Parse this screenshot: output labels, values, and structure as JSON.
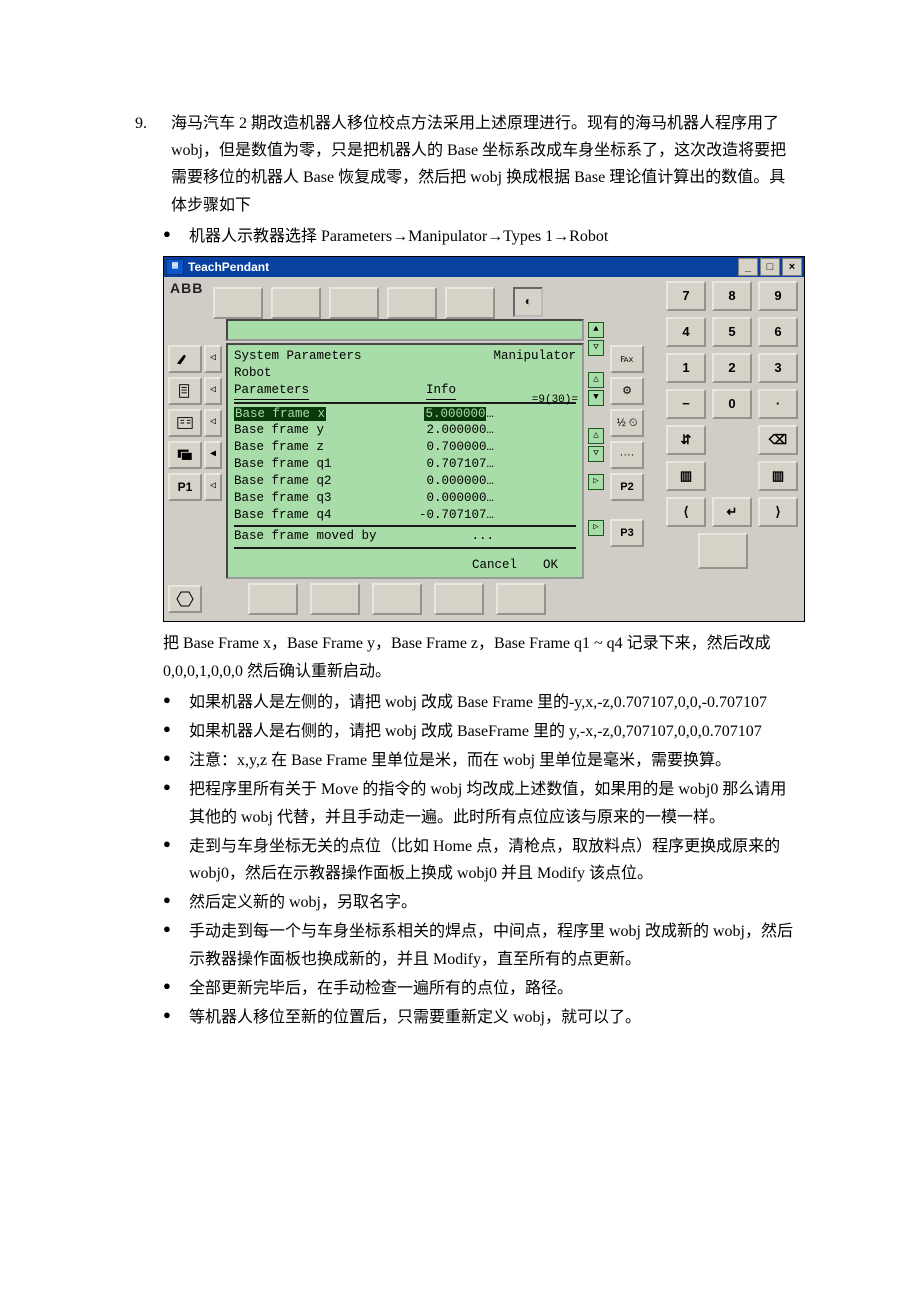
{
  "section": {
    "num": "9.",
    "text": "海马汽车 2 期改造机器人移位校点方法采用上述原理进行。现有的海马机器人程序用了 wobj，但是数值为零，只是把机器人的 Base 坐标系改成车身坐标系了，这次改造将要把需要移位的机器人 Base 恢复成零，然后把 wobj 换成根据 Base 理论值计算出的数值。具体步骤如下"
  },
  "step_nav": "机器人示教器选择 Parameters→Manipulator→Types 1→Robot",
  "pendant": {
    "window_title": "TeachPendant",
    "logo": "ABB",
    "mode_icon": "◐",
    "keypad": {
      "r1": [
        "7",
        "8",
        "9"
      ],
      "r2": [
        "4",
        "5",
        "6"
      ],
      "r3": [
        "1",
        "2",
        "3"
      ],
      "r4": [
        "−",
        "0",
        "·"
      ]
    },
    "screen": {
      "title_left": "System Parameters",
      "title_right": "Manipulator",
      "line2_left": "Robot",
      "menu_left": "Parameters",
      "menu_right": "Info",
      "counter": "=9(30)=",
      "rows": [
        {
          "k": "Base frame x",
          "v": "5.000000",
          "sel": true
        },
        {
          "k": "Base frame y",
          "v": "2.000000"
        },
        {
          "k": "Base frame z",
          "v": "0.700000"
        },
        {
          "k": "Base frame q1",
          "v": "0.707107"
        },
        {
          "k": "Base frame q2",
          "v": "0.000000"
        },
        {
          "k": "Base frame q3",
          "v": "0.000000"
        },
        {
          "k": "Base frame q4",
          "v": "-0.707107"
        },
        {
          "k": "Base frame moved by",
          "v": "..."
        }
      ],
      "footer": {
        "cancel": "Cancel",
        "ok": "OK"
      }
    },
    "left_icons": [
      "pen",
      "doc",
      "io",
      "windows",
      "p1"
    ],
    "left_labels": {
      "p1": "P1"
    },
    "fn": {
      "top": "℻",
      "mid1": "⚙",
      "mid2": "½ ⏲",
      "bot": "····",
      "p2": "P2",
      "p3": "P3"
    },
    "right_icons": {
      "tree": "⇵",
      "del": "⌫",
      "fileA": "▥",
      "fileB": "▥",
      "arrowL": "⟨",
      "enter": "↵",
      "arrowR": "⟩"
    }
  },
  "after_img": "把 Base Frame x，Base Frame y，Base Frame z，Base Frame q1 ~ q4 记录下来，然后改成 0,0,0,1,0,0,0 然后确认重新启动。",
  "bullets2": [
    "如果机器人是左侧的，请把 wobj 改成 Base Frame 里的-y,x,-z,0.707107,0,0,-0.707107",
    "如果机器人是右侧的，请把 wobj 改成 BaseFrame 里的 y,-x,-z,0,707107,0,0,0.707107",
    "注意：x,y,z 在 Base Frame 里单位是米，而在 wobj 里单位是毫米，需要换算。",
    "把程序里所有关于 Move 的指令的 wobj 均改成上述数值，如果用的是 wobj0 那么请用其他的 wobj 代替，并且手动走一遍。此时所有点位应该与原来的一模一样。",
    "走到与车身坐标无关的点位（比如 Home 点，清枪点，取放料点）程序更换成原来的 wobj0，然后在示教器操作面板上换成 wobj0 并且 Modify 该点位。",
    "然后定义新的 wobj，另取名字。",
    "手动走到每一个与车身坐标系相关的焊点，中间点，程序里 wobj 改成新的 wobj，然后示教器操作面板也换成新的，并且 Modify，直至所有的点更新。",
    "全部更新完毕后，在手动检查一遍所有的点位，路径。",
    "等机器人移位至新的位置后，只需要重新定义 wobj，就可以了。"
  ]
}
